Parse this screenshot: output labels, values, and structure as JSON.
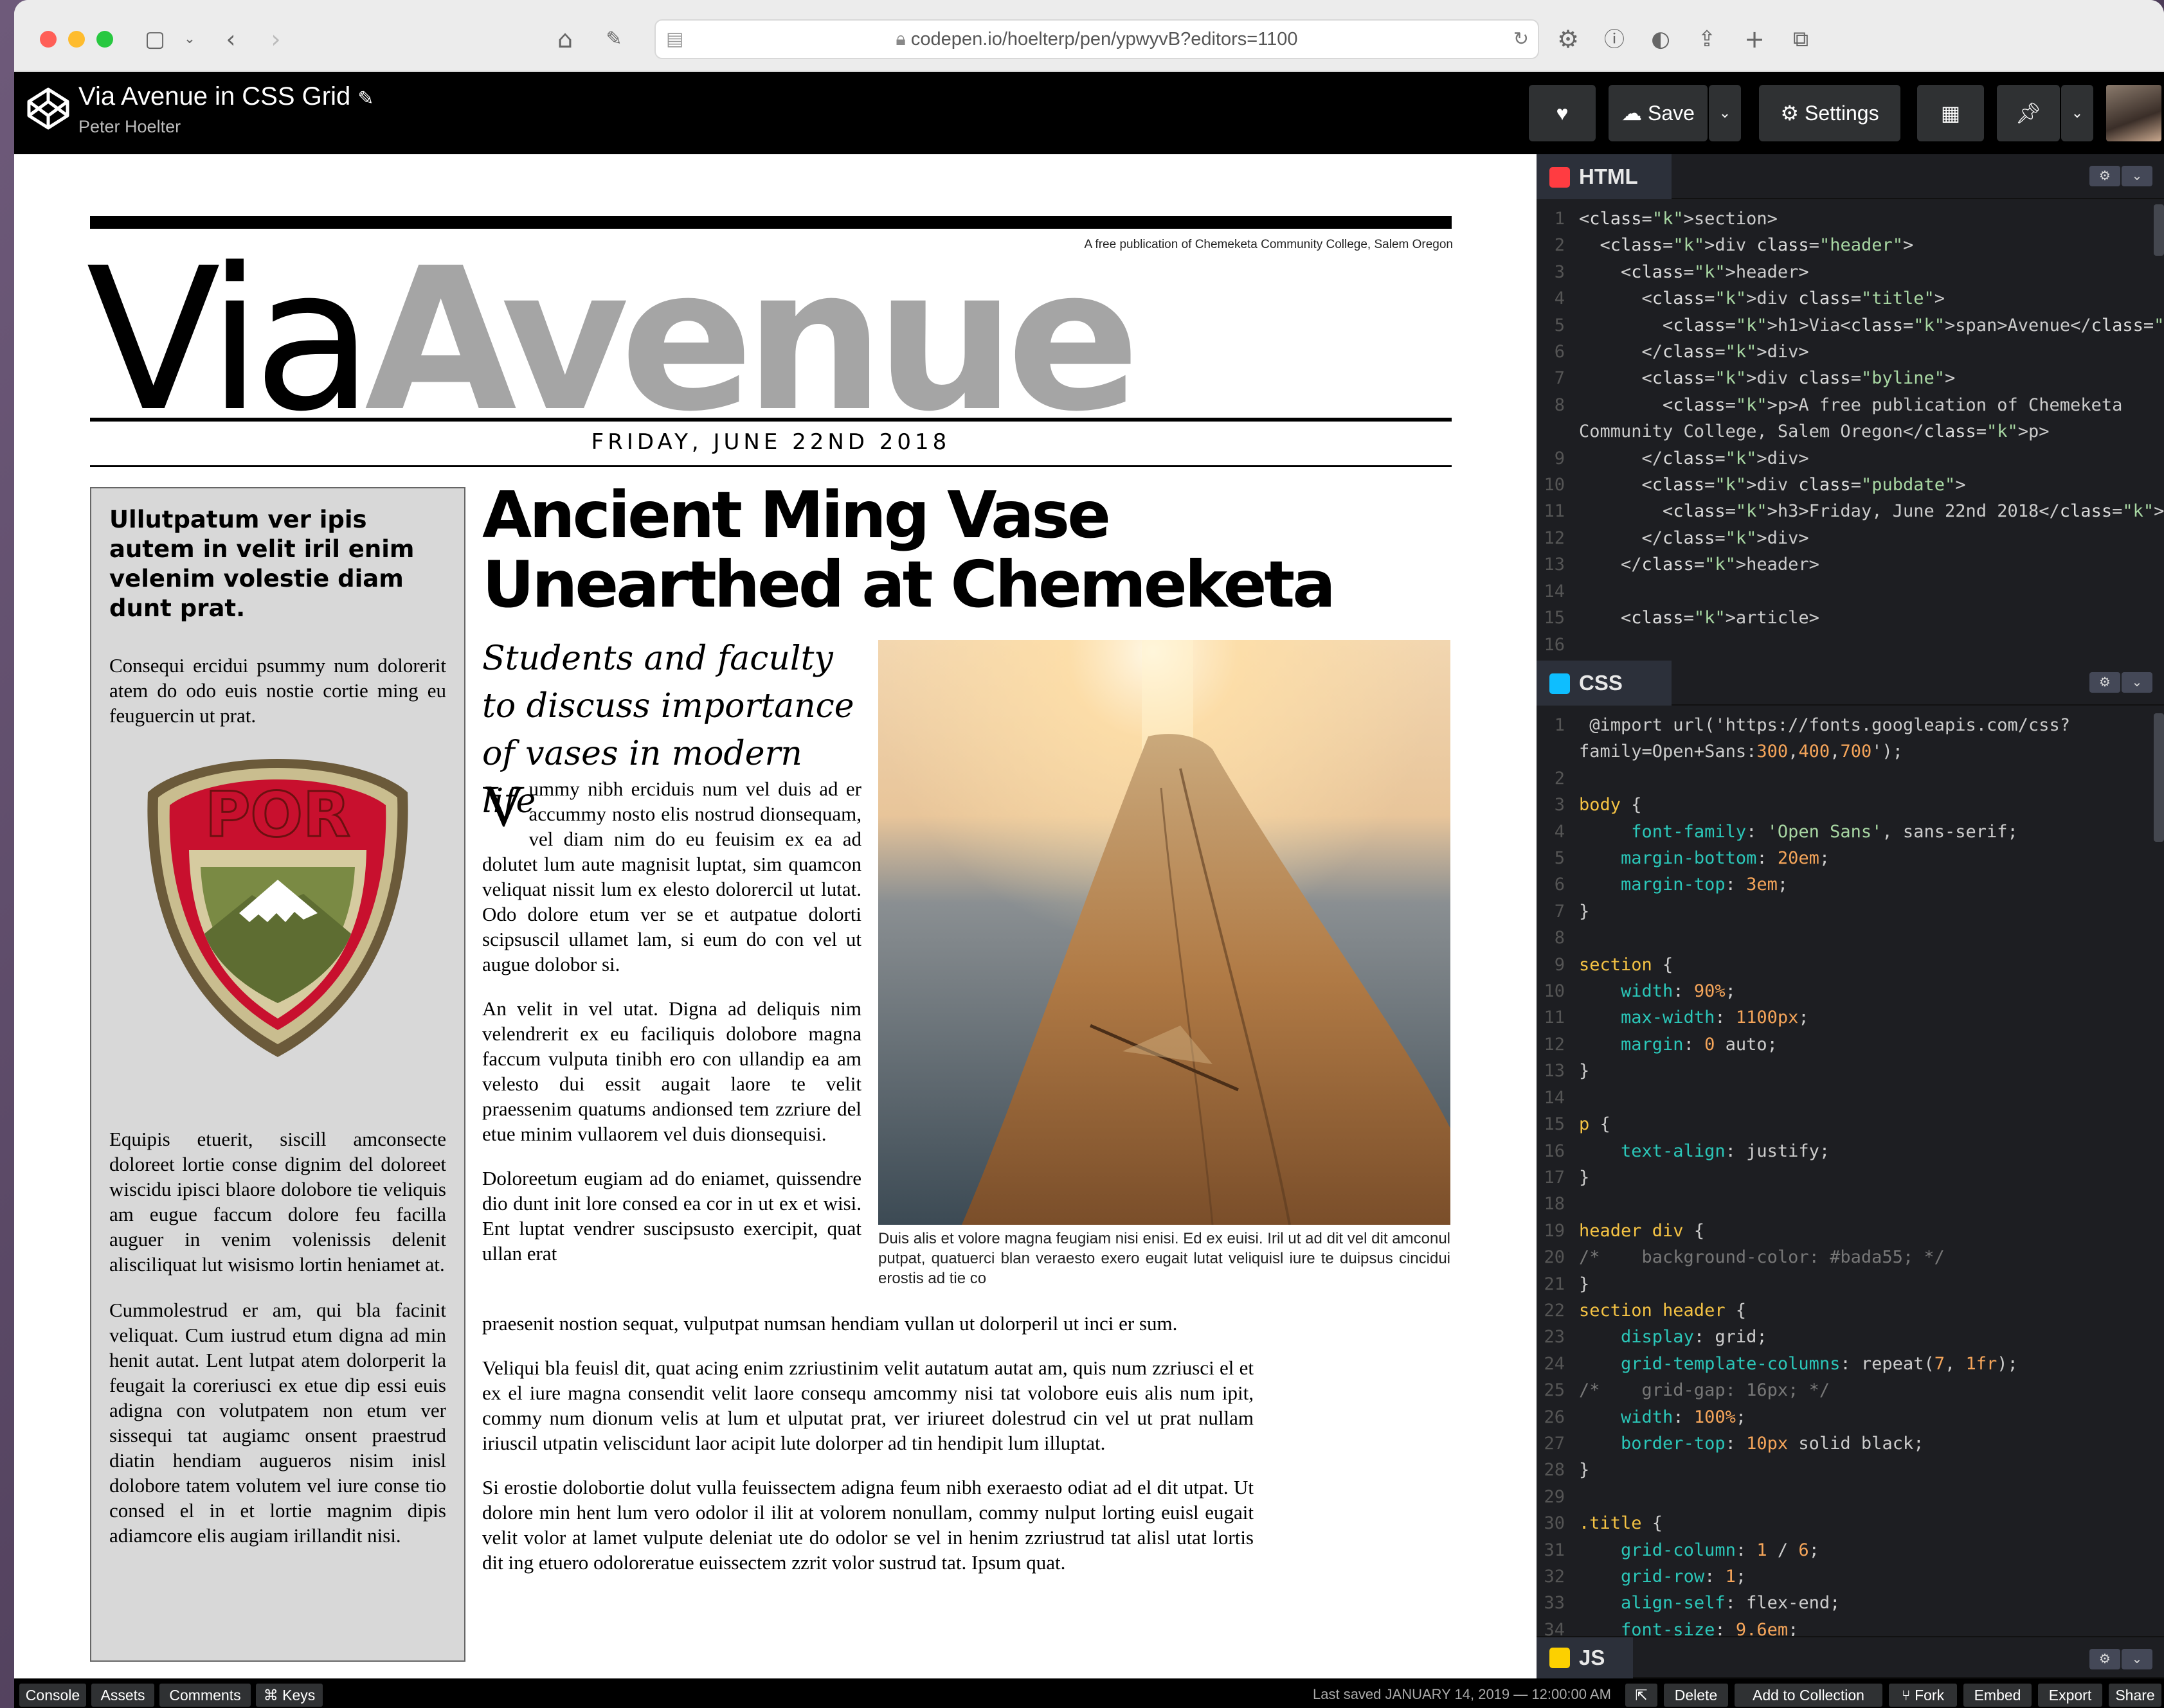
{
  "browser": {
    "url": "codepen.io/hoelterp/pen/ypwyvB?editors=1100"
  },
  "codepen": {
    "pen_title": "Via Avenue in CSS Grid",
    "author": "Peter Hoelter",
    "save_label": "Save",
    "settings_label": "Settings"
  },
  "page": {
    "byline": "A free publication of Chemeketa Community College, Salem Oregon",
    "masthead_light": "Via",
    "masthead_bold": "Avenue",
    "pubdate": "FRIDAY, JUNE 22ND 2018",
    "sidebar": {
      "heading": "Ullutpatum ver ipis autem in velit iril enim velenim volestie diam dunt prat.",
      "p1": "Consequi ercidui psummy num dolorerit atem do odo euis nostie cortie ming eu feuguercin ut prat.",
      "badge_text": "POR",
      "p2": "Equipis etuerit, siscill amconsecte doloreet lortie conse dignim del doloreet wiscidu ipisci blaore dolobore tie veliquis am eugue faccum dolore feu facilla auguer in venim volenissis delenit alisciliquat lut wisismo lortin heniamet at.",
      "p3": "Cummolestrud er am, qui bla facinit veliquat. Cum iustrud etum digna ad min henit autat. Lent lutpat atem dolorperit la feugait la coreriusci ex etue dip essi euis adigna con volutpatem non etum ver sissequi tat augiamc onsent praestrud diatin hendiam augueros nisim inisl dolobore tatem volutem vel iure conse tio consed el in et lortie magnim dipis adiamcore elis augiam irillandit nisi."
    },
    "headline": "Ancient Ming Vase Unearthed at Chemeketa",
    "deck": "Students and faculty to discuss importance of vases in modern life",
    "drop_cap": "V",
    "p1": "ummy nibh erciduis num vel duis ad er accummy nosto elis nostrud dionsequam, vel diam nim do eu feuisim ex ea ad dolutet lum aute magnisit luptat, sim quamcon veliquat nissit lum ex elesto dolorercil ut lutat. Odo dolore etum ver se et autpatue dolorti scipsuscil ullamet lam, si eum do con vel ut augue dolobor si.",
    "p2": "An velit in vel utat. Digna ad deliquis nim velendrerit ex eu faciliquis dolobore magna faccum vulputa tinibh ero con ullandip ea am velesto dui essit augait laore te velit praessenim quatums andionsed tem zzriure del etue minim vullaorem vel duis dionsequisi.",
    "p3a": "Doloreetum eugiam ad do eniamet, quissendre dio dunt init lore consed ea cor in ut ex et wisi. Ent luptat vendrer suscipsusto exercipit, quat ullan erat",
    "p3b": "praesenit nostion sequat, vulputpat numsan hendiam vullan ut dolorperil ut inci er sum.",
    "p4": "Veliqui bla feuisl dit, quat acing enim zzriustinim velit autatum autat am, quis num zzriusci el et ex el iure magna consendit velit laore consequ amcommy nisi tat volobore euis alis num ipit, commy num dionum velis at lum et ulputat prat, ver iriureet dolestrud cin vel ut prat nullam iriuscil utpatin veliscidunt laor acipit lute dolorper ad tin hendipit lum illuptat.",
    "p5": "Si erostie dolobortie dolut vulla feuissectem adigna feum nibh exeraesto odiat ad el dit utpat. Ut dolore min hent lum vero odolor il ilit at volorem nonullam, commy nulput lorting euisl eugait velit volor at lamet vulpute deleniat ute do odolor se vel in henim zzriustrud tat alisl utat lortis dit ing etuero odoloreratue euissectem zzrit volor sustrud tat. Ipsum quat.",
    "caption": "Duis alis et volore magna feugiam nisi enisi. Ed ex euisi. Iril ut ad dit vel dit amconul putpat, quatuerci blan veraesto exero eugait lutat veliquisl iure te duipsus cincidui erostis ad tie co"
  },
  "editor": {
    "html_label": "HTML",
    "css_label": "CSS",
    "js_label": "JS",
    "html_lines": [
      "<section>",
      "  <div class=\"header\">",
      "    <header>",
      "      <div class=\"title\">",
      "        <h1>Via<span>Avenue</span></h1>",
      "      </div>",
      "      <div class=\"byline\">",
      "        <p>A free publication of Chemeketa",
      "Community College, Salem Oregon</p>",
      "      </div>",
      "      <div class=\"pubdate\">",
      "        <h3>Friday, June 22nd 2018</h3>",
      "      </div>",
      "    </header>",
      "",
      "    <article>",
      ""
    ],
    "css_lines": [
      " @import url('https://fonts.googleapis.com/css?",
      "family=Open+Sans:300,400,700');",
      "",
      "body {",
      "     font-family: 'Open Sans', sans-serif;",
      "    margin-bottom: 20em;",
      "    margin-top: 3em;",
      "}",
      "",
      "section {",
      "    width: 90%;",
      "    max-width: 1100px;",
      "    margin: 0 auto;",
      "}",
      "",
      "p {",
      "    text-align: justify;",
      "}",
      "",
      "header div {",
      "/*    background-color: #bada55; */",
      "}",
      "section header {",
      "    display: grid;",
      "    grid-template-columns: repeat(7, 1fr);",
      "/*    grid-gap: 16px; */",
      "    width: 100%;",
      "    border-top: 10px solid black;",
      "}",
      "",
      ".title {",
      "    grid-column: 1 / 6;",
      "    grid-row: 1;",
      "    align-self: flex-end;",
      "    font-size: 9.6em;"
    ]
  },
  "bottom": {
    "console": "Console",
    "assets": "Assets",
    "comments": "Comments",
    "keys": "⌘ Keys",
    "last_saved": "Last saved JANUARY 14, 2019 — 12:00:00 AM",
    "delete": "Delete",
    "add_collection": "Add to Collection",
    "fork": "⑂ Fork",
    "embed": "Embed",
    "export": "Export",
    "share": "Share"
  },
  "colors": {
    "masthead_gray": "#a5a5a5",
    "sidebar_bg": "#d8d8d8",
    "editor_bg": "#1d1e22",
    "html_icon": "#ff3c41",
    "css_icon": "#0ebeff",
    "js_icon": "#fcd000"
  }
}
